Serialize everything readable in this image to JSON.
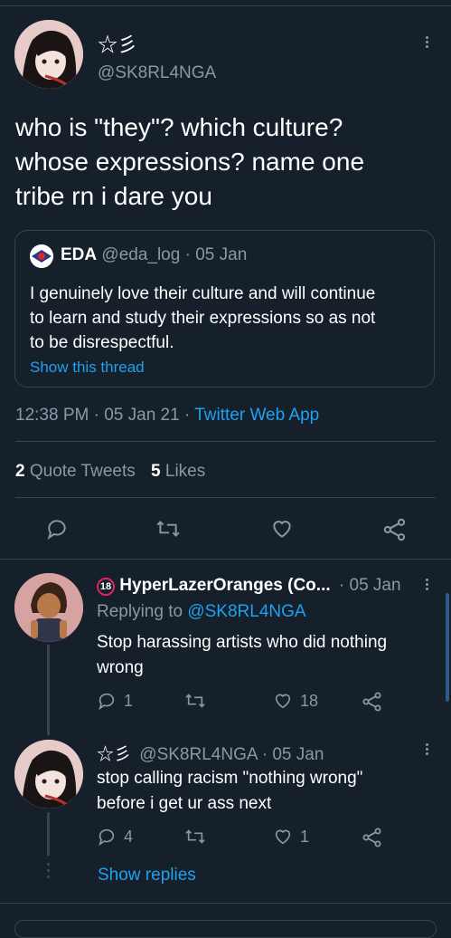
{
  "main_tweet": {
    "display_name": "☆彡",
    "handle": "@SK8RL4NGA",
    "text_lines": [
      "who is \"they\"? which culture?",
      "whose expressions? name one",
      "tribe rn i dare you"
    ],
    "quoted": {
      "name": "EDA",
      "handle": "@eda_log",
      "date": "· 05 Jan",
      "text_lines": [
        "I genuinely love their culture and will continue",
        "to learn and study their expressions so as not",
        "to be disrespectful."
      ],
      "show_thread": "Show this thread"
    },
    "time": "12:38 PM · 05 Jan 21 ·",
    "source": "Twitter Web App",
    "quote_count": "2",
    "quote_label": "Quote Tweets",
    "like_count": "5",
    "like_label": "Likes"
  },
  "replies": [
    {
      "badge": "18",
      "display_name": "HyperLazerOranges (Co...",
      "date": "· 05 Jan",
      "replying_prefix": "Replying to",
      "replying_handle": "@SK8RL4NGA",
      "text_lines": [
        "Stop harassing artists who did nothing",
        "wrong"
      ],
      "replies": "1",
      "likes": "18"
    },
    {
      "display_name": "☆彡",
      "handle_date": "@SK8RL4NGA · 05 Jan",
      "text_lines": [
        "stop calling racism \"nothing wrong\"",
        "before i get ur ass next"
      ],
      "replies": "4",
      "likes": "1"
    }
  ],
  "show_replies": "Show replies",
  "colors": {
    "background": "#15202b",
    "accent": "#1da1f2",
    "muted": "#8899a6",
    "divider": "#38444d"
  }
}
